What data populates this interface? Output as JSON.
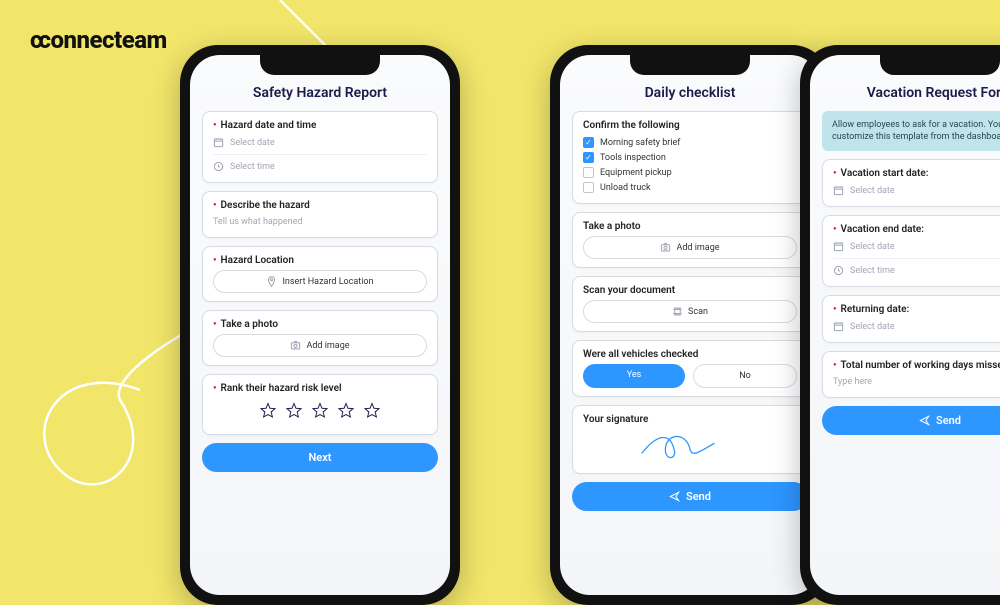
{
  "logo": "connecteam",
  "phone1": {
    "title": "Safety Hazard Report",
    "hazard_dt_label": "Hazard date and time",
    "select_date": "Select date",
    "select_time": "Select time",
    "describe_label": "Describe the hazard",
    "describe_ph": "Tell us what happened",
    "location_label": "Hazard Location",
    "location_ph": "Insert Hazard Location",
    "photo_label": "Take a photo",
    "add_image": "Add image",
    "rank_label": "Rank their hazard risk level",
    "next": "Next"
  },
  "phone2": {
    "title": "Daily checklist",
    "confirm_label": "Confirm the following",
    "items": [
      {
        "label": "Morning safety brief",
        "checked": true
      },
      {
        "label": "Tools inspection",
        "checked": true
      },
      {
        "label": "Equipment pickup",
        "checked": false
      },
      {
        "label": "Unload truck",
        "checked": false
      }
    ],
    "photo_label": "Take a photo",
    "add_image": "Add image",
    "scan_label": "Scan your document",
    "scan": "Scan",
    "vehicles_label": "Were all vehicles checked",
    "yes": "Yes",
    "no": "No",
    "sig_label": "Your signature",
    "send": "Send"
  },
  "phone3": {
    "title": "Vacation Request Form",
    "info": "Allow employees to ask for a vacation. You can customize this template from the dashboard",
    "start_label": "Vacation start date:",
    "end_label": "Vacation end date:",
    "return_label": "Returning date:",
    "select_date": "Select date",
    "select_time": "Select time",
    "days_label": "Total number of working days missed:",
    "type_here": "Type here",
    "send": "Send"
  }
}
